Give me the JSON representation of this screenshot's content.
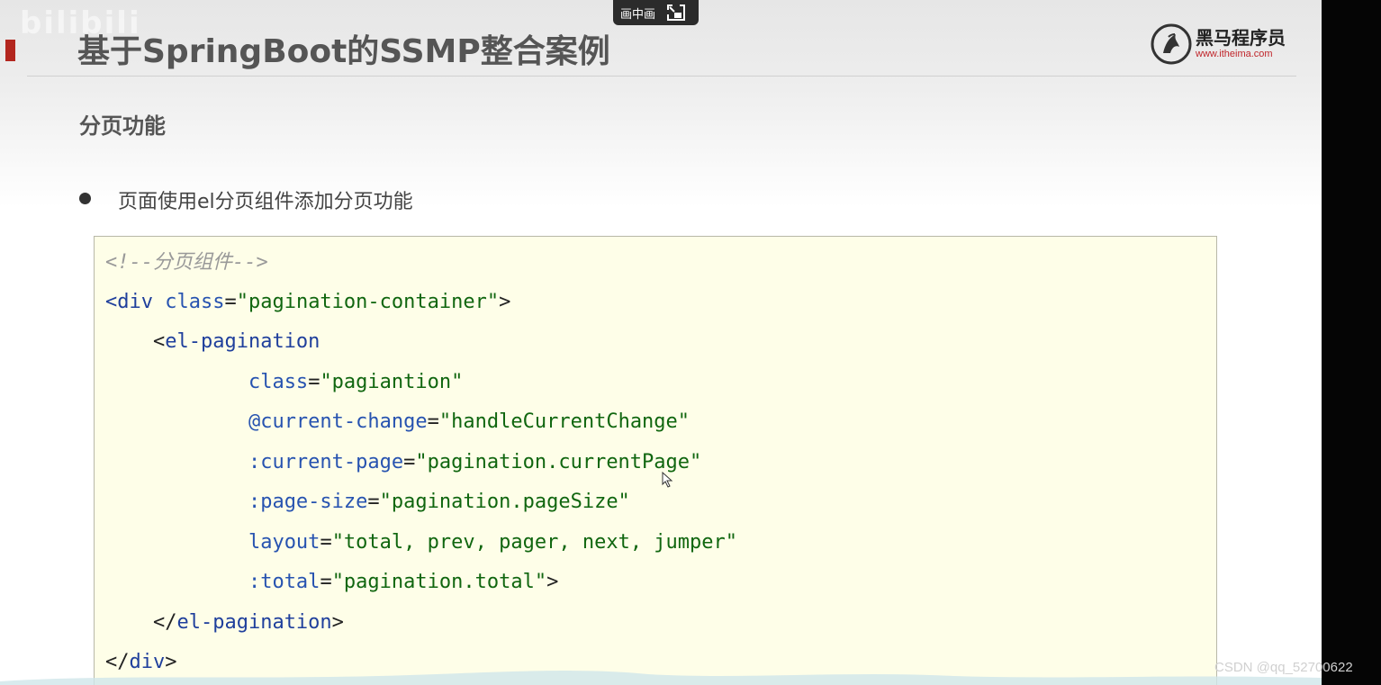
{
  "overlay": {
    "pip_label": "画中画",
    "bili_watermark": "bilibili"
  },
  "slide": {
    "title": "基于SpringBoot的SSMP整合案例",
    "logo": {
      "name": "黑马程序员",
      "url": "www.itheima.com"
    },
    "section_title": "分页功能",
    "bullet": "页面使用el分页组件添加分页功能",
    "code": {
      "comment": "<!--分页组件-->",
      "div_open_tag": "<div",
      "div_attr": "class",
      "div_eq": "=",
      "div_value": "\"pagination-container\"",
      "div_close_bracket": ">",
      "el_open_bracket": "<",
      "el_tag": "el-pagination",
      "attr1_name": "class",
      "attr1_value": "\"pagiantion\"",
      "attr2_name": "@current-change",
      "attr2_value": "\"handleCurrentChange\"",
      "attr3_name": ":current-page",
      "attr3_value": "\"pagination.currentPage\"",
      "attr4_name": ":page-size",
      "attr4_value": "\"pagination.pageSize\"",
      "attr5_name": "layout",
      "attr5_value": "\"total, prev, pager, next, jumper\"",
      "attr6_name": ":total",
      "attr6_value": "\"pagination.total\"",
      "attr6_close": ">",
      "el_close_open": "</",
      "el_close_tag": "el-pagination",
      "el_close_bracket": ">",
      "div_close_open": "</",
      "div_close_tag": "div",
      "div_close_end": ">"
    }
  },
  "footer_watermark": "CSDN @qq_52700622",
  "colors": {
    "code_background": "#fefee8",
    "tag": "#1f3f9c",
    "string": "#10660f",
    "comment": "#999999",
    "brand_red": "#c0252a"
  }
}
